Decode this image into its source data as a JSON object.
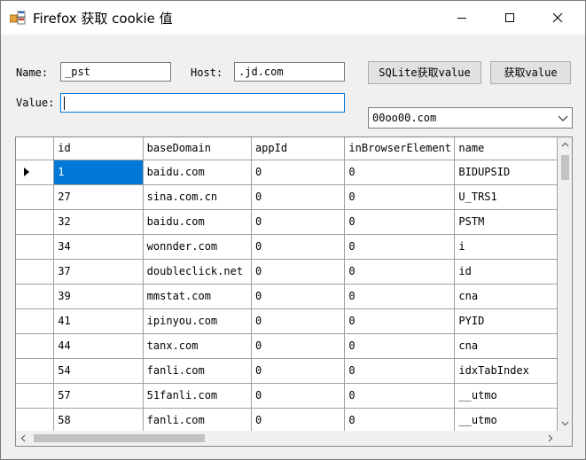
{
  "window": {
    "title": "Firefox 获取 cookie 值"
  },
  "form": {
    "name_label": "Name:",
    "name_value": "_pst",
    "host_label": "Host:",
    "host_value": ".jd.com",
    "value_label": "Value:",
    "value_value": ""
  },
  "buttons": {
    "sqlite_label": "SQLite获取value",
    "get_label": "获取value"
  },
  "profile_select": {
    "selected": "00oo00.com"
  },
  "grid": {
    "columns": [
      "id",
      "baseDomain",
      "appId",
      "inBrowserElement",
      "name"
    ],
    "rows": [
      [
        "1",
        "baidu.com",
        "0",
        "0",
        "BIDUPSID"
      ],
      [
        "27",
        "sina.com.cn",
        "0",
        "0",
        "U_TRS1"
      ],
      [
        "32",
        "baidu.com",
        "0",
        "0",
        "PSTM"
      ],
      [
        "34",
        "wonnder.com",
        "0",
        "0",
        "i"
      ],
      [
        "37",
        "doubleclick.net",
        "0",
        "0",
        "id"
      ],
      [
        "39",
        "mmstat.com",
        "0",
        "0",
        "cna"
      ],
      [
        "41",
        "ipinyou.com",
        "0",
        "0",
        "PYID"
      ],
      [
        "44",
        "tanx.com",
        "0",
        "0",
        "cna"
      ],
      [
        "54",
        "fanli.com",
        "0",
        "0",
        "idxTabIndex"
      ],
      [
        "57",
        "51fanli.com",
        "0",
        "0",
        "__utmo"
      ],
      [
        "58",
        "fanli.com",
        "0",
        "0",
        "__utmo"
      ]
    ],
    "selected_row": 0,
    "selected_col": 0
  },
  "colors": {
    "selection": "#0078d7",
    "focus_border": "#0078d7"
  }
}
